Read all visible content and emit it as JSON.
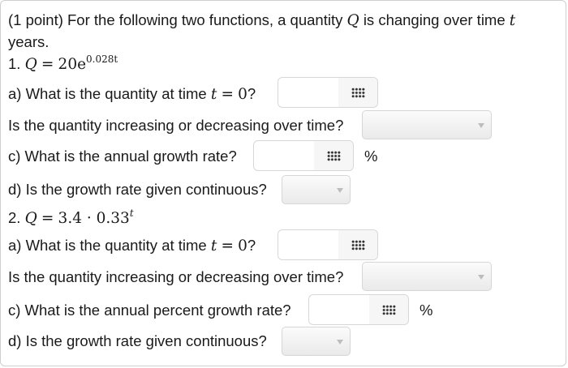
{
  "problem": {
    "intro_part1": "(1 point) For the following two functions, a quantity",
    "Q_var": "Q",
    "intro_part2": "is changing over time",
    "t_var": "t",
    "intro_line2": "years."
  },
  "func1": {
    "num": "1.",
    "lhs": "Q",
    "eq": "=",
    "base": "20e",
    "exp": "0.028t"
  },
  "q1a": {
    "label": "a) What is the quantity at time",
    "var": "t",
    "eq": "=",
    "val": "0",
    "end": "?",
    "value": ""
  },
  "q1b": {
    "label": "Is the quantity increasing or decreasing over time?",
    "selected": ""
  },
  "q1c": {
    "label": "c) What is the annual growth rate?",
    "value": "",
    "unit": "%"
  },
  "q1d": {
    "label": "d) Is the growth rate given continuous?",
    "selected": ""
  },
  "func2": {
    "num": "2.",
    "lhs": "Q",
    "eq": "=",
    "base": "3.4 · 0.33",
    "exp": "t"
  },
  "q2a": {
    "label": "a) What is the quantity at time",
    "var": "t",
    "eq": "=",
    "val": "0",
    "end": "?",
    "value": ""
  },
  "q2b": {
    "label": "Is the quantity increasing or decreasing over time?",
    "selected": ""
  },
  "q2c": {
    "label": "c) What is the annual percent growth rate?",
    "value": "",
    "unit": "%"
  },
  "q2d": {
    "label": "d) Is the growth rate given continuous?",
    "selected": ""
  },
  "icons": {
    "keypad": "keypad-grid-icon",
    "dropdown": "chevron-down-icon"
  }
}
